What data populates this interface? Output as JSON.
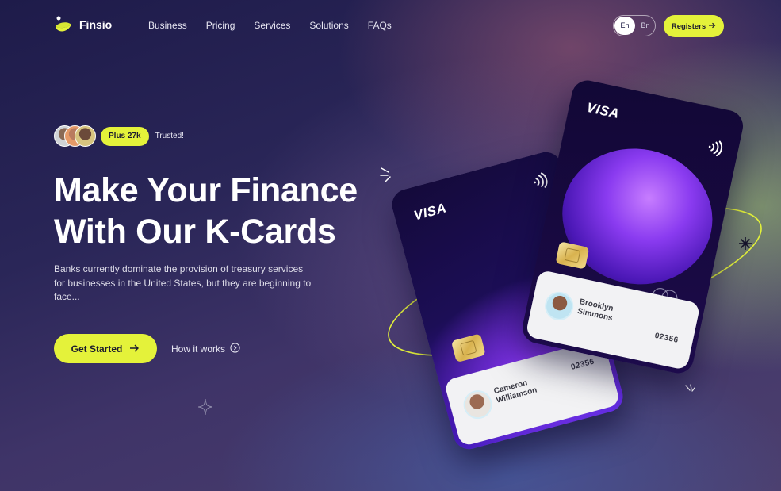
{
  "brand": {
    "name": "Finsio",
    "accent": "#E4F23A",
    "background": "#2A2658"
  },
  "nav": {
    "links": [
      "Business",
      "Pricing",
      "Services",
      "Solutions",
      "FAQs"
    ],
    "lang_selected": "En",
    "lang_other": "Bn",
    "register_label": "Registers"
  },
  "hero": {
    "trusted_badge": "Plus 27k",
    "trusted_label": "Trusted!",
    "title_line1": "Make Your Finance",
    "title_line2": "With Our K-Cards",
    "description": "Banks currently dominate the provision of treasury services for businesses in the United States, but they are beginning to face...",
    "cta_primary": "Get Started",
    "cta_secondary": "How it works"
  },
  "cards": [
    {
      "brand": "VISA",
      "holder_line1": "Cameron",
      "holder_line2": "Williamson",
      "number": "02356"
    },
    {
      "brand": "VISA",
      "holder_line1": "Brooklyn",
      "holder_line2": "Simmons",
      "number": "02356"
    }
  ],
  "icons": {
    "logo": "crescent-dot-logo-icon",
    "register_arrow": "arrow-right-icon",
    "cta_arrow": "arrow-right-icon",
    "how_it_works": "circle-chevron-right-icon",
    "contactless": "contactless-icon",
    "mastercard": "mastercard-icon"
  }
}
